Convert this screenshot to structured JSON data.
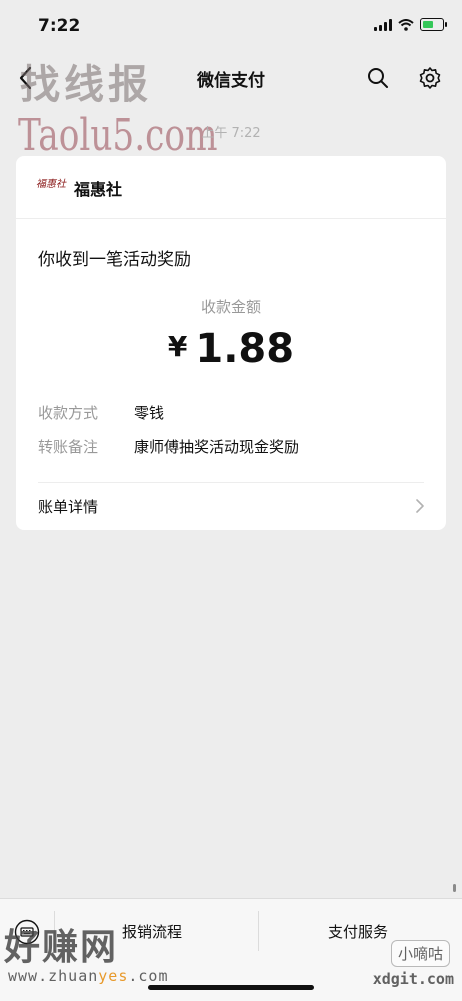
{
  "status_bar": {
    "time": "7:22",
    "battery_level": 0.6
  },
  "nav": {
    "title": "微信支付"
  },
  "watermarks": {
    "top_text": "找线报",
    "top_url": "Taolu5.com",
    "bottom_text": "好赚网",
    "bottom_url_prefix": "www.zhuan",
    "bottom_url_highlight": "yes",
    "bottom_url_suffix": ".com",
    "xdg_badge": "小嘀咕",
    "xdg_url": "xdgit.com"
  },
  "message": {
    "timestamp": "上午 7:22",
    "brand": {
      "logo_text": "福惠社",
      "name": "福惠社"
    },
    "notice": "你收到一笔活动奖励",
    "amount_label": "收款金额",
    "currency": "¥",
    "amount": "1.88",
    "details": [
      {
        "key": "收款方式",
        "value": "零钱"
      },
      {
        "key": "转账备注",
        "value": "康师傅抽奖活动现金奖励"
      }
    ],
    "bill_label": "账单详情"
  },
  "bottom_tabs": [
    {
      "label": "报销流程"
    },
    {
      "label": "支付服务"
    }
  ],
  "colors": {
    "page_bg": "#ededed",
    "card_bg": "#ffffff",
    "muted_text": "#999999",
    "battery_green": "#35c759"
  }
}
